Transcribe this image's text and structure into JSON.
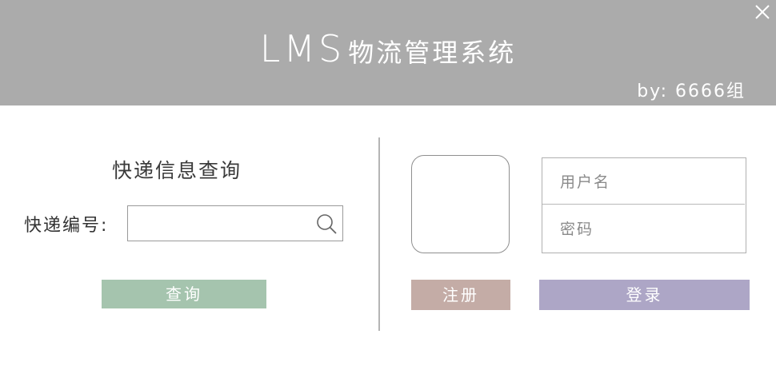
{
  "header": {
    "title_brand": "LMS",
    "title_sub": "物流管理系统",
    "byline": "by: 6666组",
    "background": "#ababab"
  },
  "window_controls": {
    "close_icon": "close-icon"
  },
  "query_panel": {
    "title": "快递信息查询",
    "tracking_label": "快递编号:",
    "tracking_value": "",
    "search_icon": "search-icon",
    "query_button": "查询",
    "query_button_color": "#a5c4ae"
  },
  "login_panel": {
    "avatar": "",
    "username_placeholder": "用户名",
    "password_placeholder": "密码",
    "register_button": "注册",
    "login_button": "登录",
    "register_color": "#c4aca6",
    "login_color": "#ada6c6"
  }
}
